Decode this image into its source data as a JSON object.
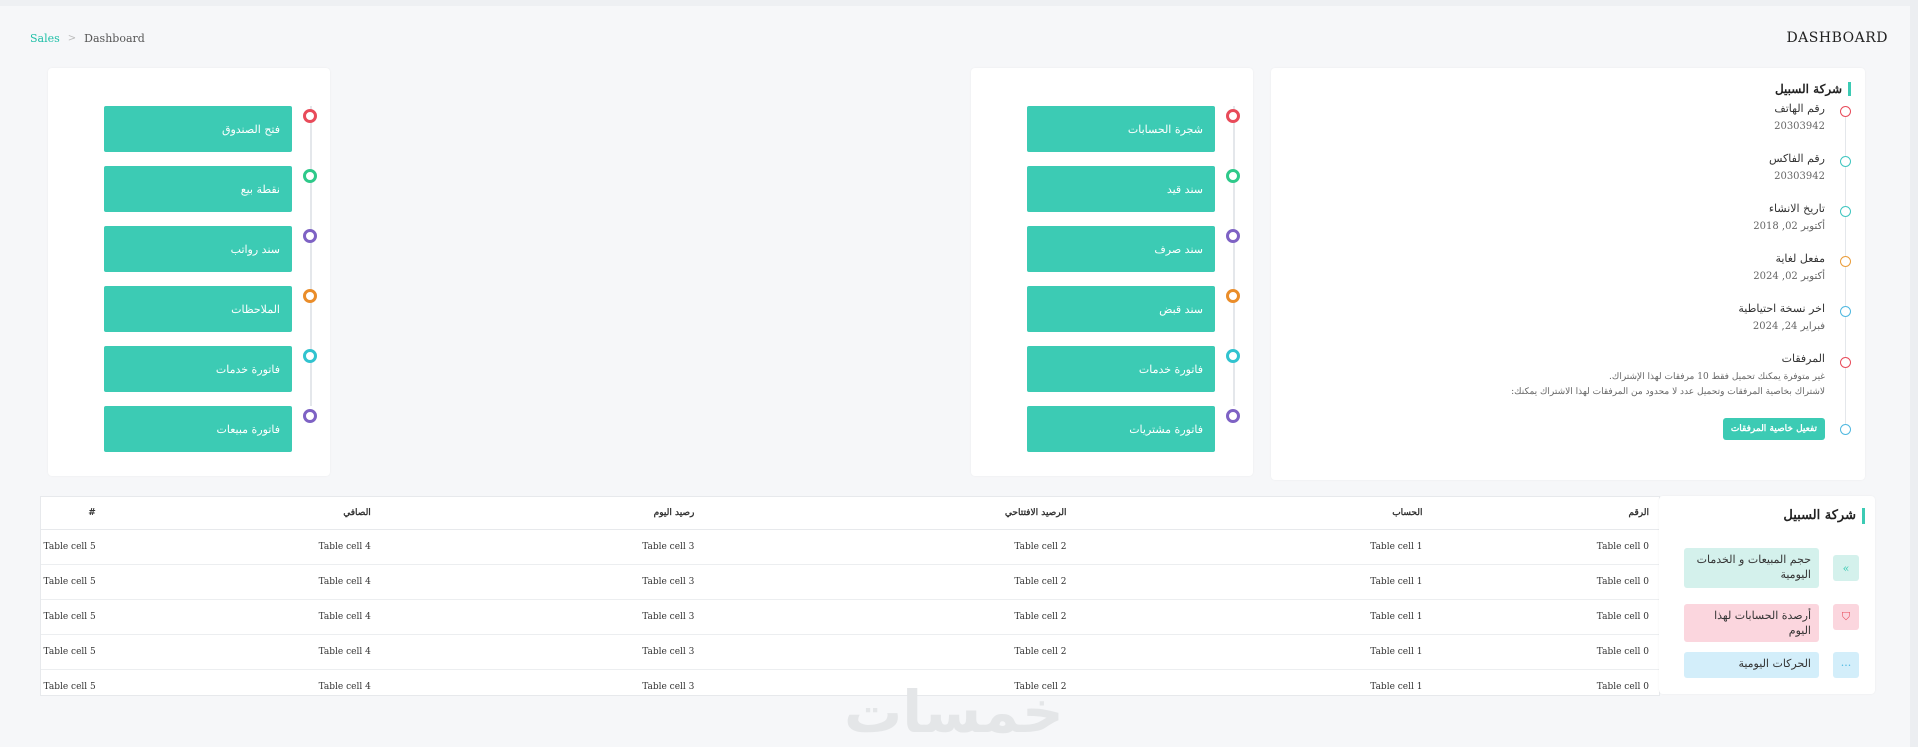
{
  "breadcrumb": {
    "link": "Sales",
    "separator": ">",
    "current": "Dashboard"
  },
  "page_title": "DASHBOARD",
  "left_actions": [
    {
      "label": "فتح الصندوق",
      "color": "#e84b5a"
    },
    {
      "label": "نقطة بيع",
      "color": "#2ec98a"
    },
    {
      "label": "سند رواتب",
      "color": "#7e62c4"
    },
    {
      "label": "الملاحظات",
      "color": "#ea8d2a"
    },
    {
      "label": "فاتورة خدمات",
      "color": "#31c3cf"
    },
    {
      "label": "فاتورة مبيعات",
      "color": "#7e62c4"
    }
  ],
  "middle_actions": [
    {
      "label": "شجرة الحسابات",
      "color": "#e84b5a"
    },
    {
      "label": "سند قيد",
      "color": "#2ec98a"
    },
    {
      "label": "سند صرف",
      "color": "#7e62c4"
    },
    {
      "label": "سند قبض",
      "color": "#ea8d2a"
    },
    {
      "label": "فاتورة خدمات",
      "color": "#31c3cf"
    },
    {
      "label": "فاتورة مشتريات",
      "color": "#7e62c4"
    }
  ],
  "company": {
    "title": "شركة السبيل",
    "items": [
      {
        "label": "رقم الهاتف",
        "value": "20303942",
        "color": "#e84b5a"
      },
      {
        "label": "رقم الفاكس",
        "value": "20303942",
        "color": "#3fc6c0"
      },
      {
        "label": "تاريخ الانشاء",
        "value": "أكتوبر 02, 2018",
        "color": "#3fc6c0"
      },
      {
        "label": "مفعل لغاية",
        "value": "أكتوبر 02, 2024",
        "color": "#ea9d3a"
      },
      {
        "label": "اخر نسخة احتياطية",
        "value": "فبراير 24, 2024",
        "color": "#4fb8e0"
      }
    ],
    "attachments": {
      "label": "المرفقات",
      "note_line1": "غير متوفرة يمكنك تحميل فقط 10 مرفقات لهذا الإشتراك.",
      "note_line2": "لاشتراك بخاصية المرفقات وتحميل عدد لا محدود من المرفقات لهذا الاشتراك يمكنك:",
      "color": "#e84b5a",
      "button_label": "تفعيل خاصية المرفقات",
      "button_dot_color": "#4fb8e0"
    }
  },
  "table": {
    "headers": [
      "الرقم",
      "الحساب",
      "الرصيد الافتتاحي",
      "رصيد اليوم",
      "الصافي",
      "#"
    ],
    "rows": [
      [
        "Table cell 0",
        "Table cell 1",
        "Table cell 2",
        "Table cell 3",
        "Table cell 4",
        "Table cell 5"
      ],
      [
        "Table cell 0",
        "Table cell 1",
        "Table cell 2",
        "Table cell 3",
        "Table cell 4",
        "Table cell 5"
      ],
      [
        "Table cell 0",
        "Table cell 1",
        "Table cell 2",
        "Table cell 3",
        "Table cell 4",
        "Table cell 5"
      ],
      [
        "Table cell 0",
        "Table cell 1",
        "Table cell 2",
        "Table cell 3",
        "Table cell 4",
        "Table cell 5"
      ],
      [
        "Table cell 0",
        "Table cell 1",
        "Table cell 2",
        "Table cell 3",
        "Table cell 4",
        "Table cell 5"
      ]
    ]
  },
  "stats": {
    "title": "شركة السبيل",
    "items": [
      {
        "label": "حجم المبيعات و الخدمات اليومية",
        "icon": "double-chevron-left-icon",
        "glyph": "«",
        "bg": "#d4f1ec",
        "icon_bg": "#d4f1ec",
        "icon_color": "#3ccbb4"
      },
      {
        "label": "أرصدة الحسابات لهذا اليوم",
        "icon": "bookmark-icon",
        "glyph": "⛉",
        "bg": "#fbd6de",
        "icon_bg": "#fbd6de",
        "icon_color": "#e84b5a"
      },
      {
        "label": "الحركات اليومية",
        "icon": "ellipsis-icon",
        "glyph": "···",
        "bg": "#d3eefa",
        "icon_bg": "#d3eefa",
        "icon_color": "#4fb8e0"
      }
    ]
  },
  "watermark": "خمسات"
}
